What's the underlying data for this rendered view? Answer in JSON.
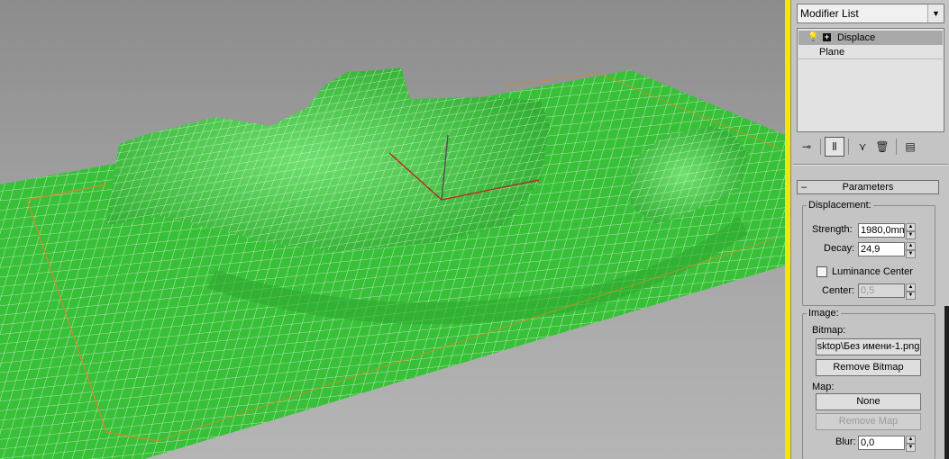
{
  "modifier_list": {
    "label": "Modifier List"
  },
  "stack": {
    "items": [
      {
        "label": "Displace",
        "selected": true
      },
      {
        "label": "Plane",
        "selected": false
      }
    ]
  },
  "toolbar": {
    "icons": [
      "pin-stack-icon",
      "show-end-result-icon",
      "make-unique-icon",
      "remove-modifier-icon",
      "configure-modifier-sets-icon"
    ]
  },
  "parameters": {
    "title": "Parameters",
    "displacement": {
      "title": "Displacement:",
      "strength_label": "Strength:",
      "strength_value": "1980,0mm",
      "decay_label": "Decay:",
      "decay_value": "24,9",
      "luminance_center_label": "Luminance Center",
      "luminance_center_checked": false,
      "center_label": "Center:",
      "center_value": "0,5"
    },
    "image": {
      "title": "Image:",
      "bitmap_label": "Bitmap:",
      "bitmap_button": "sktop\\Без имени-1.png",
      "remove_bitmap": "Remove Bitmap",
      "map_label": "Map:",
      "map_button": "None",
      "remove_map": "Remove Map",
      "blur_label": "Blur:",
      "blur_value": "0,0"
    }
  },
  "colors": {
    "mesh": "#3cc43c",
    "wire": "#ffffff",
    "selection_bracket": "#f3e600",
    "bounds": "#d08a2a",
    "gizmo_x": "#c02020"
  }
}
